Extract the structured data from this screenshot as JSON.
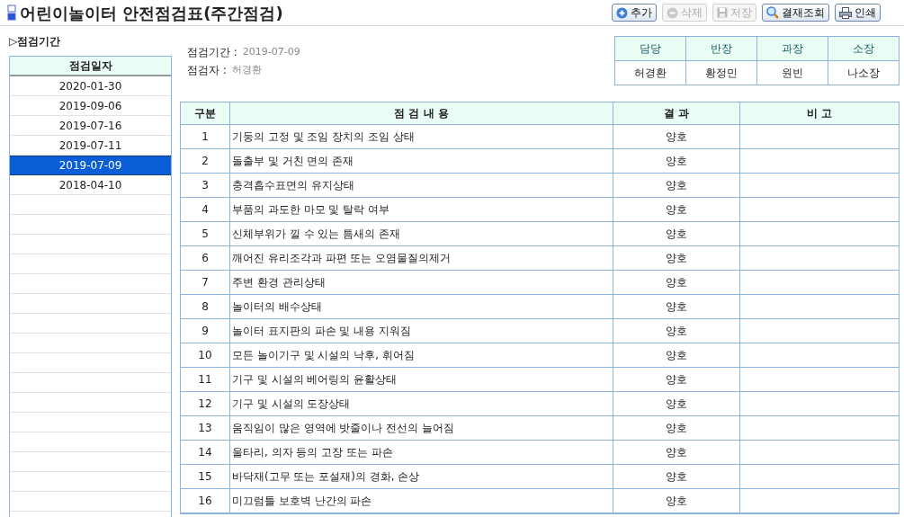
{
  "page_title": "어린이놀이터 안전점검표(주간점검)",
  "toolbar": [
    {
      "label": "추가",
      "kind": "add",
      "disabled": false
    },
    {
      "label": "삭제",
      "kind": "delete",
      "disabled": true
    },
    {
      "label": "저장",
      "kind": "save",
      "disabled": true
    },
    {
      "label": "결재조회",
      "kind": "search",
      "disabled": false
    },
    {
      "label": "인쇄",
      "kind": "print",
      "disabled": false
    }
  ],
  "sidebar": {
    "heading": "▷점검기간",
    "column": "점검일자",
    "items": [
      {
        "label": "2020-01-30",
        "selected": false
      },
      {
        "label": "2019-09-06",
        "selected": false
      },
      {
        "label": "2019-07-16",
        "selected": false
      },
      {
        "label": "2019-07-11",
        "selected": false
      },
      {
        "label": "2019-07-09",
        "selected": true
      },
      {
        "label": "2018-04-10",
        "selected": false
      }
    ]
  },
  "info": [
    {
      "label": "점검기간 :",
      "value": "2019-07-09"
    },
    {
      "label": "점검자 :",
      "value": "허경환"
    }
  ],
  "approval": {
    "columns": [
      "담당",
      "반장",
      "과장",
      "소장"
    ],
    "names": [
      "허경환",
      "황정민",
      "원빈",
      "나소장"
    ]
  },
  "table": {
    "columns": [
      "구분",
      "점 검 내 용",
      "결 과",
      "비 고"
    ],
    "rows": [
      [
        "1",
        "기둥의 고정 및 조임 장치의 조임 상태",
        "양호"
      ],
      [
        "2",
        "돌출부 및 거친 면의 존재",
        "양호"
      ],
      [
        "3",
        "충격흡수표면의 유지상태",
        "양호"
      ],
      [
        "4",
        "부품의 과도한 마모 및 탈락 여부",
        "양호"
      ],
      [
        "5",
        "신체부위가 낄 수 있는 틈새의 존재",
        "양호"
      ],
      [
        "6",
        "깨어진 유리조각과 파편 또는 오염물질의제거",
        "양호"
      ],
      [
        "7",
        "주변 환경 관리상태",
        "양호"
      ],
      [
        "8",
        "놀이터의 배수상태",
        "양호"
      ],
      [
        "9",
        "놀이터 표지판의 파손 및 내용 지워짐",
        "양호"
      ],
      [
        "10",
        "모든 놀이기구 및 시설의 낙후, 휘어짐",
        "양호"
      ],
      [
        "11",
        "기구 및 시설의 베어링의 윤활상태",
        "양호"
      ],
      [
        "12",
        "기구 및 시설의 도장상태",
        "양호"
      ],
      [
        "13",
        "움직임이 많은 영역에 밧줄이나 전선의 늘어짐",
        "양호"
      ],
      [
        "14",
        "울타리, 의자 등의 고장 또는 파손",
        "양호"
      ],
      [
        "15",
        "바닥재(고무 또는 포설재)의 경화, 손상",
        "양호"
      ],
      [
        "16",
        "미끄럼틀 보호벽 난간의 파손",
        "양호"
      ]
    ]
  }
}
